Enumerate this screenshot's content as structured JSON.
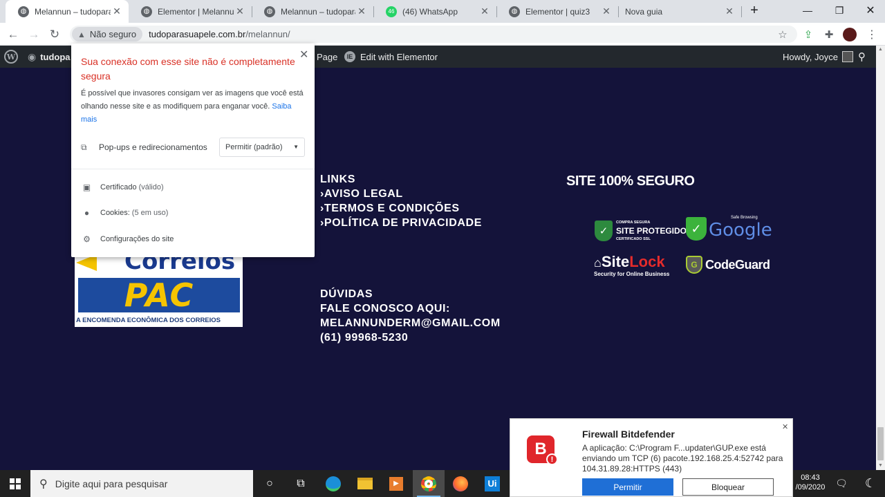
{
  "browser": {
    "tabs": [
      {
        "title": "Melannun – tudoparasu",
        "active": true,
        "favicon": "globe-icon"
      },
      {
        "title": "Elementor | Melannun",
        "active": false,
        "favicon": "globe-icon"
      },
      {
        "title": "Melannun – tudoparasu",
        "active": false,
        "favicon": "globe-icon"
      },
      {
        "title": "(46) WhatsApp",
        "active": false,
        "favicon": "whatsapp-icon"
      },
      {
        "title": "Elementor | quiz3",
        "active": false,
        "favicon": "globe-icon"
      },
      {
        "title": "Nova guia",
        "active": false,
        "favicon": "none"
      }
    ],
    "new_tab": "+",
    "security_label": "Não seguro",
    "url_domain": "tudoparasuapele.com.br",
    "url_path": "/melannun/"
  },
  "wp_admin_bar": {
    "site_name": "tudopa",
    "edit_page": "Page",
    "edit_with_elementor": "Edit with Elementor",
    "howdy": "Howdy, Joyce"
  },
  "site_info_popup": {
    "warning_title": "Sua conexão com esse site não é completamente segura",
    "description": "É possível que invasores consigam ver as imagens que você está olhando nesse site e as modifiquem para enganar você.",
    "learn_more": "Saiba mais",
    "permission_label": "Pop-ups e redirecionamentos",
    "permission_value": "Permitir (padrão)",
    "certificate": "Certificado",
    "certificate_status": "(válido)",
    "cookies": "Cookies:",
    "cookies_status": "(5 em uso)",
    "site_settings": "Configurações do site"
  },
  "footer": {
    "links_title": "LINKS",
    "links": [
      "›AVISO LEGAL",
      "›TERMOS E CONDIÇÕES",
      "›POLÍTICA DE PRIVACIDADE"
    ],
    "contact": [
      "DÚVIDAS",
      "FALE CONOSCO AQUI:",
      "MELANNUNDERM@GMAIL.COM",
      "(61) 99968-5230"
    ],
    "secure_title": "SITE 100% SEGURO",
    "correios": {
      "word": "Correios",
      "pac": "PAC",
      "subtitle": "A ENCOMENDA ECONÔMICA DOS CORREIOS"
    },
    "badges": {
      "site_protegido_top": "COMPRA SEGURA",
      "site_protegido_main": "SITE PROTEGIDO",
      "site_protegido_bottom": "CERTIFICADO SSL",
      "google_top": "Safe Browsing",
      "google_main": "Google",
      "sitelock_site": "Site",
      "sitelock_lock": "Lock",
      "sitelock_sub": "Security for Online Business",
      "codeguard": "CodeGuard"
    }
  },
  "bitdefender": {
    "title": "Firewall Bitdefender",
    "message": "A aplicação: C:\\Program F...updater\\GUP.exe está enviando um TCP (6) pacote.192.168.25.4:52742 para 104.31.89.28:HTTPS (443)",
    "allow": "Permitir",
    "block": "Bloquear"
  },
  "taskbar": {
    "search_placeholder": "Digite aqui para pesquisar",
    "time": "08:43",
    "date": "/09/2020"
  }
}
